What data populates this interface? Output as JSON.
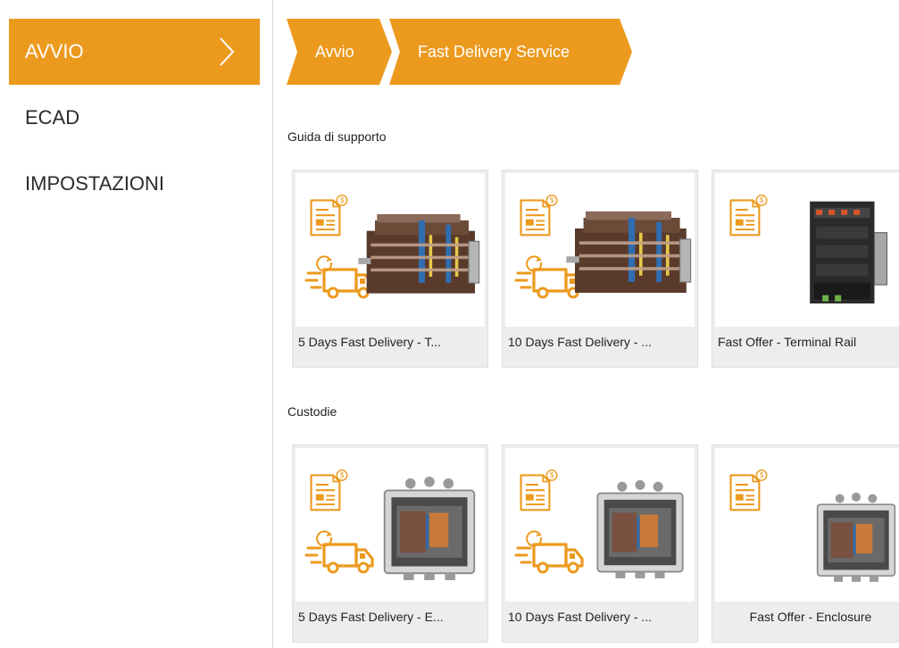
{
  "sidebar": {
    "items": [
      {
        "label": "AVVIO",
        "active": true
      },
      {
        "label": "ECAD",
        "active": false
      },
      {
        "label": "IMPOSTAZIONI",
        "active": false
      }
    ]
  },
  "breadcrumb": [
    "Avvio",
    "Fast Delivery Service"
  ],
  "colors": {
    "accent": "#ec9a1e",
    "card_bg": "#ededed"
  },
  "sections": [
    {
      "title": "Guida di supporto",
      "cards": [
        {
          "caption": "5 Days Fast Delivery - T...",
          "icons": [
            "document-offer-icon",
            "delivery-truck-icon"
          ],
          "product": "terminal-block-assembly"
        },
        {
          "caption": "10 Days Fast Delivery - ...",
          "icons": [
            "document-offer-icon",
            "delivery-truck-icon"
          ],
          "product": "terminal-block-assembly"
        },
        {
          "caption": "Fast Offer - Terminal Rail",
          "icons": [
            "document-offer-icon"
          ],
          "product": "terminal-rail-assembly"
        }
      ]
    },
    {
      "title": "Custodie",
      "cards": [
        {
          "caption": "5 Days Fast Delivery - E...",
          "icons": [
            "document-offer-icon",
            "delivery-truck-icon"
          ],
          "product": "enclosure"
        },
        {
          "caption": "10 Days Fast Delivery - ...",
          "icons": [
            "document-offer-icon",
            "delivery-truck-icon"
          ],
          "product": "enclosure"
        },
        {
          "caption": "Fast Offer - Enclosure",
          "icons": [
            "document-offer-icon"
          ],
          "product": "enclosure"
        }
      ]
    }
  ]
}
